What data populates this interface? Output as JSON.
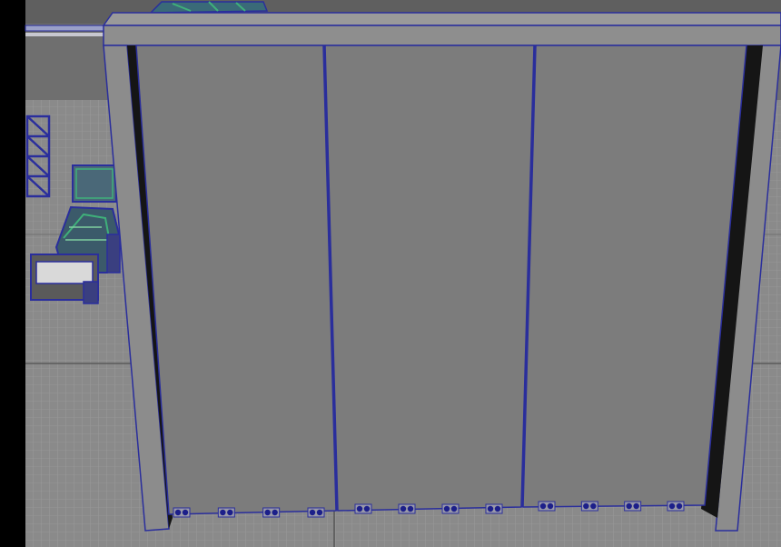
{
  "viewport": {
    "panel_label": "",
    "background_color": "#000000",
    "floor_color": "#8a8a8a",
    "grid_line_color": "#a9a9a9",
    "backdrop_color": "#6f6f6f",
    "wall_color": "#7c7c7c",
    "frame_color": "#8f8f8f",
    "wireframe_color": "#2a2e9c",
    "selection_color": "#3fb07a"
  },
  "scene": {
    "objects": [
      {
        "name": "sliding-door-wall",
        "panel_count": 3,
        "rollers_per_panel": 4
      },
      {
        "name": "forklift-vehicle"
      },
      {
        "name": "storage-rack"
      },
      {
        "name": "overhead-object"
      }
    ]
  }
}
